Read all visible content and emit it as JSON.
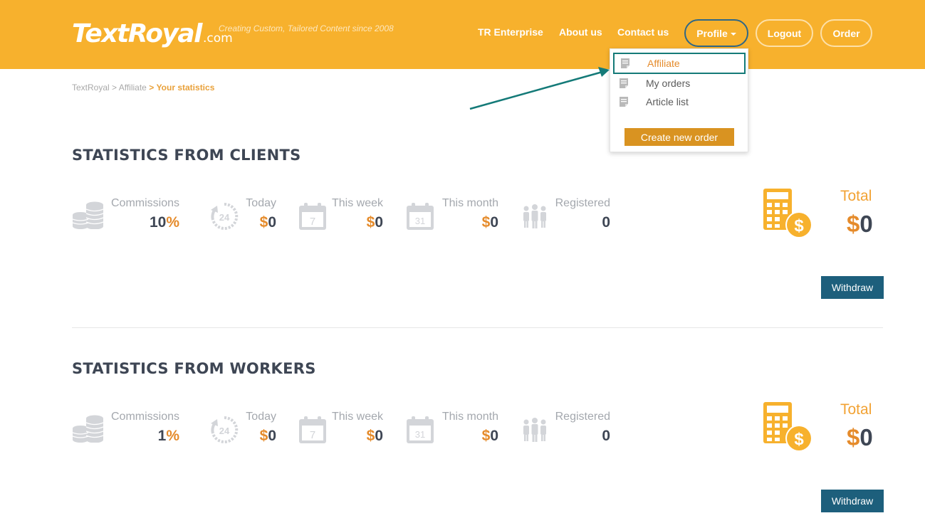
{
  "header": {
    "logo_text": "TextRoyal",
    "logo_suffix": ".com",
    "tagline": "Creating Custom, Tailored Content since 2008",
    "nav": {
      "enterprise": "TR Enterprise",
      "about": "About us",
      "contact": "Contact us",
      "profile": "Profile",
      "logout": "Logout",
      "order": "Order"
    }
  },
  "dropdown": {
    "items": [
      {
        "label": "Affiliate",
        "icon": "document-icon"
      },
      {
        "label": "My orders",
        "icon": "document-icon"
      },
      {
        "label": "Article list",
        "icon": "document-icon"
      }
    ],
    "button": "Create new order"
  },
  "breadcrumb": {
    "home": "TextRoyal",
    "sep": ">",
    "parent": "Affiliate",
    "current": "Your statistics"
  },
  "clients": {
    "title": "STATISTICS FROM CLIENTS",
    "commissions": {
      "label": "Commissions",
      "value": "10",
      "unit": "%"
    },
    "today": {
      "label": "Today",
      "currency": "$",
      "value": "0"
    },
    "week": {
      "label": "This week",
      "currency": "$",
      "value": "0"
    },
    "month": {
      "label": "This month",
      "currency": "$",
      "value": "0"
    },
    "registered": {
      "label": "Registered",
      "value": "0"
    },
    "total": {
      "label": "Total",
      "currency": "$",
      "value": "0"
    },
    "withdraw": "Withdraw"
  },
  "workers": {
    "title": "STATISTICS FROM WORKERS",
    "commissions": {
      "label": "Commissions",
      "value": "1",
      "unit": "%"
    },
    "today": {
      "label": "Today",
      "currency": "$",
      "value": "0"
    },
    "week": {
      "label": "This week",
      "currency": "$",
      "value": "0"
    },
    "month": {
      "label": "This month",
      "currency": "$",
      "value": "0"
    },
    "registered": {
      "label": "Registered",
      "value": "0"
    },
    "total": {
      "label": "Total",
      "currency": "$",
      "value": "0"
    },
    "withdraw": "Withdraw"
  },
  "icons": {
    "today": "24",
    "week": "7",
    "month": "31"
  },
  "colors": {
    "header": "#f7b12d",
    "accent_orange": "#e58b2b",
    "dark_text": "#3e4654",
    "withdraw_button": "#1d5f7c",
    "highlight_box": "#147a78"
  }
}
